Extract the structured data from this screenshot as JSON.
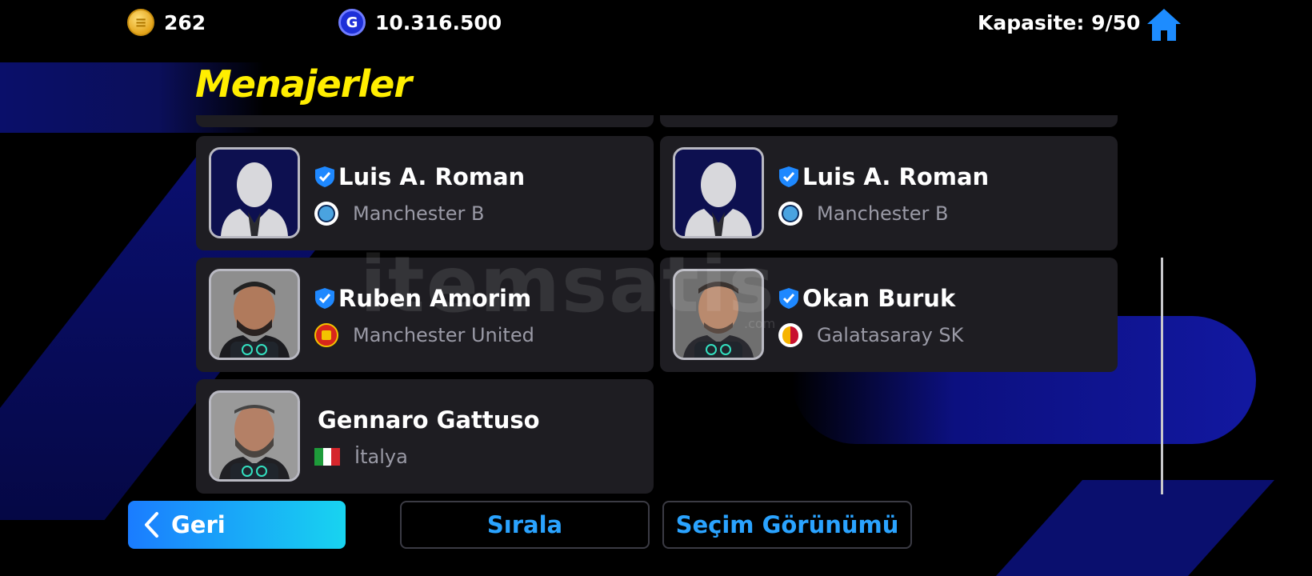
{
  "topbar": {
    "coins": "262",
    "gp": "10.316.500",
    "capacity": "Kapasite: 9/50"
  },
  "title": "Menajerler",
  "managers": [
    {
      "name": "Luis A. Roman",
      "club": "Manchester B",
      "verified": true,
      "avatar": "silhouette",
      "sub_icon": "manchester-b-crest-icon"
    },
    {
      "name": "Luis A. Roman",
      "club": "Manchester B",
      "verified": true,
      "avatar": "silhouette",
      "sub_icon": "manchester-b-crest-icon"
    },
    {
      "name": "Ruben Amorim",
      "club": "Manchester United",
      "verified": true,
      "avatar": "photo",
      "sub_icon": "manchester-united-crest-icon"
    },
    {
      "name": "Okan Buruk",
      "club": "Galatasaray SK",
      "verified": true,
      "avatar": "photo",
      "sub_icon": "galatasaray-crest-icon"
    },
    {
      "name": "Gennaro Gattuso",
      "club": "İtalya",
      "verified": false,
      "avatar": "photo",
      "sub_icon": "italy-flag-icon"
    }
  ],
  "watermark": {
    "text": "itemsatis",
    "sub": ".com"
  },
  "buttons": {
    "back": "Geri",
    "sort": "Sırala",
    "selection_view": "Seçim Görünümü"
  },
  "colors": {
    "title": "#ffee00",
    "accent": "#2aa3ff",
    "card": "#1e1d22",
    "verified": "#1e88ff"
  }
}
